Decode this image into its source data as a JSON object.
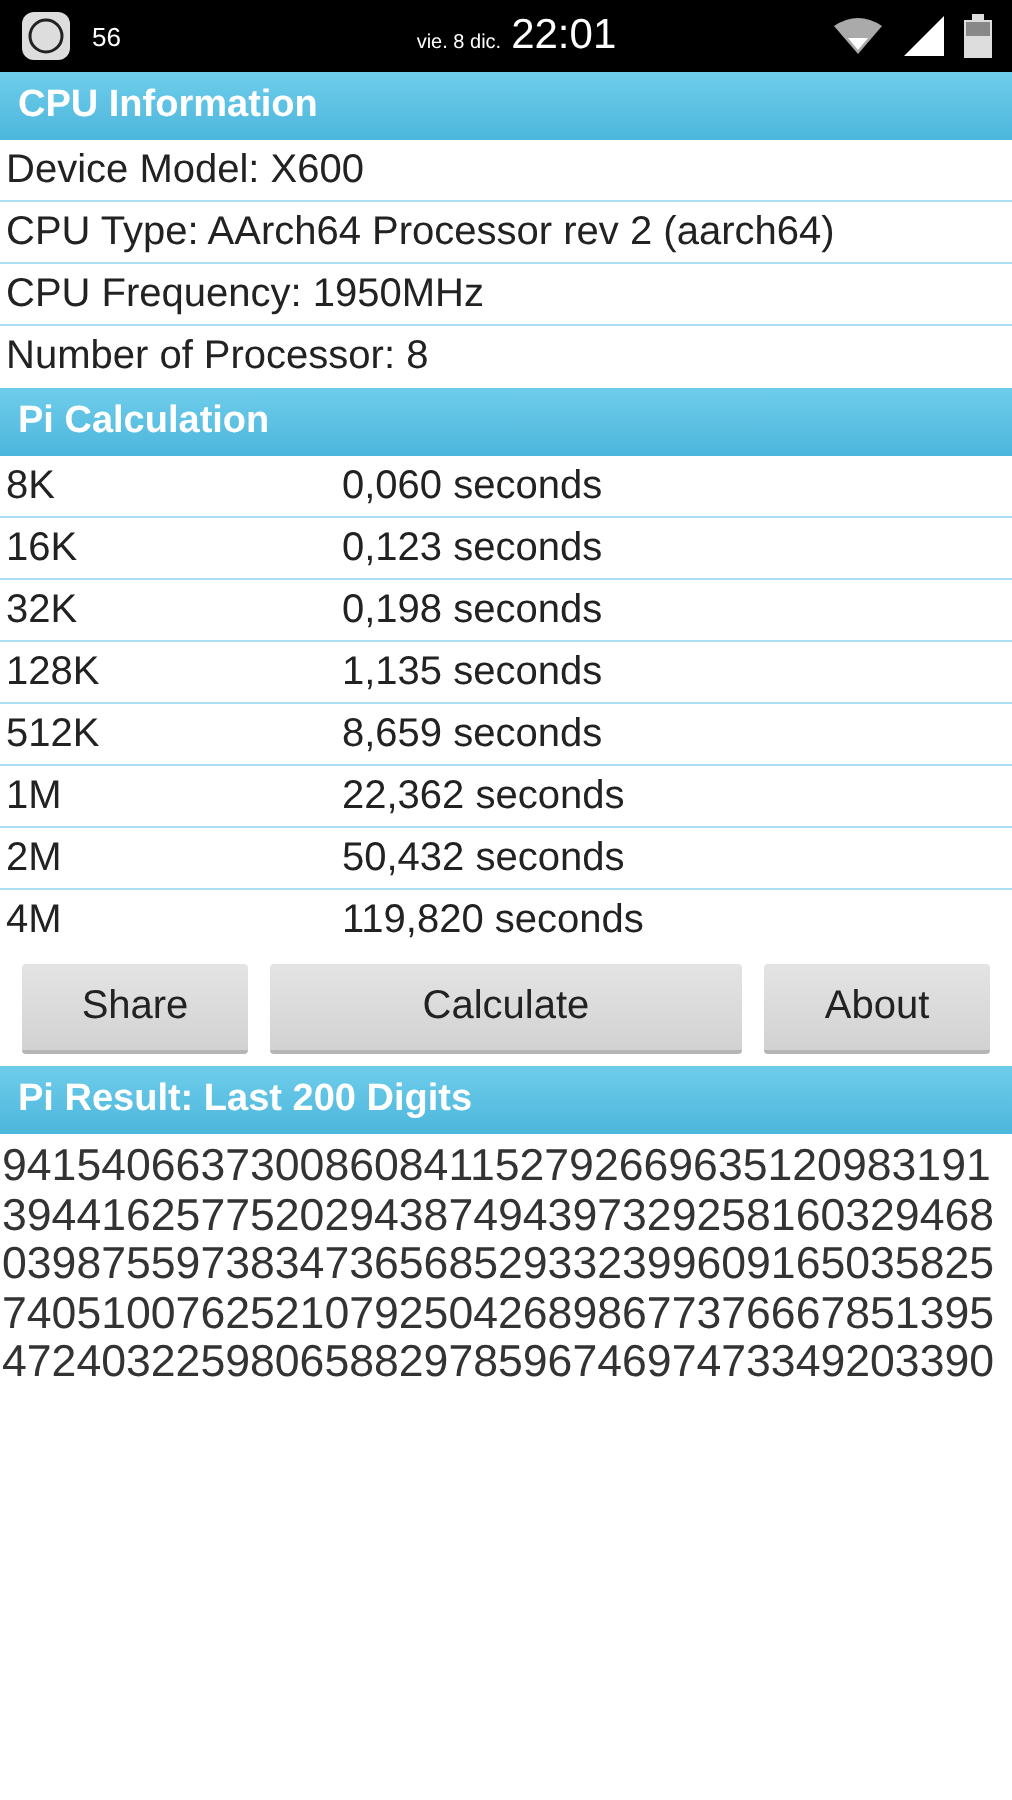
{
  "status_bar": {
    "date": "vie. 8 dic.",
    "time": "22:01",
    "notification_count": "56"
  },
  "cpu_information": {
    "title": "CPU Information",
    "rows": [
      "Device Model: X600",
      "CPU Type: AArch64 Processor rev 2 (aarch64)",
      "CPU Frequency: 1950MHz",
      "Number of Processor: 8"
    ]
  },
  "pi_calculation": {
    "title": "Pi Calculation",
    "rows": [
      {
        "size": "8K",
        "time": "0,060 seconds"
      },
      {
        "size": "16K",
        "time": "0,123 seconds"
      },
      {
        "size": "32K",
        "time": "0,198 seconds"
      },
      {
        "size": "128K",
        "time": "1,135 seconds"
      },
      {
        "size": "512K",
        "time": "8,659 seconds"
      },
      {
        "size": "1M",
        "time": "22,362 seconds"
      },
      {
        "size": "2M",
        "time": "50,432 seconds"
      },
      {
        "size": "4M",
        "time": "119,820 seconds"
      }
    ]
  },
  "buttons": [
    "Share",
    "Calculate",
    "About"
  ],
  "pi_result": {
    "title": "Pi Result: Last 200 Digits",
    "lines": [
      "9415406637300860841152792669635120983191",
      "3944162577520294387494397329258160329468",
      "0398755973834736568529332399609165035825",
      "7405100762521079250426898677376667851395",
      "4724032259806588297859674697473349203390"
    ]
  }
}
